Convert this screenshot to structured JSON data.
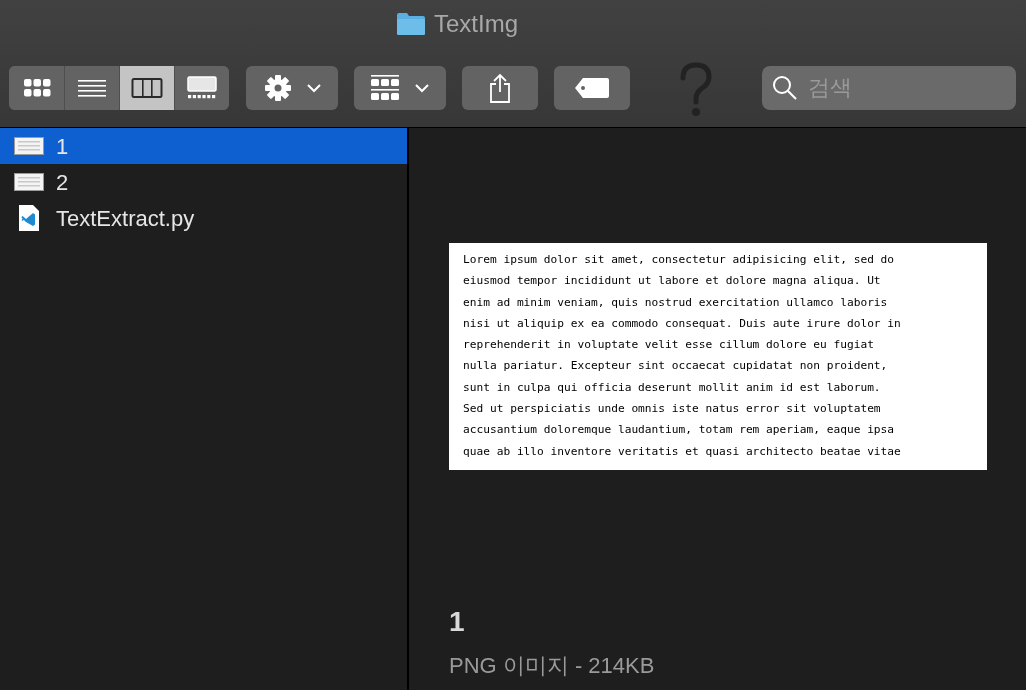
{
  "window": {
    "title": "TextImg"
  },
  "toolbar": {
    "views": [
      {
        "kind": "icons",
        "selected": false
      },
      {
        "kind": "list",
        "selected": false
      },
      {
        "kind": "columns",
        "selected": true
      },
      {
        "kind": "gallery",
        "selected": false
      }
    ],
    "search": {
      "placeholder": "검색"
    }
  },
  "files": [
    {
      "name": "1",
      "kind": "image",
      "selected": true
    },
    {
      "name": "2",
      "kind": "image",
      "selected": false
    },
    {
      "name": "TextExtract.py",
      "kind": "python",
      "selected": false
    }
  ],
  "preview": {
    "lines": [
      "Lorem ipsum dolor sit amet, consectetur adipisicing elit, sed do",
      "eiusmod tempor incididunt ut labore et dolore magna aliqua. Ut",
      "enim ad minim veniam, quis nostrud exercitation ullamco laboris",
      "nisi ut aliquip ex ea commodo consequat. Duis aute irure dolor in",
      "reprehenderit in voluptate velit esse cillum dolore eu fugiat",
      "nulla pariatur. Excepteur sint occaecat cupidatat non proident,",
      "sunt in culpa qui officia deserunt mollit anim id est laborum.",
      "Sed ut perspiciatis unde omnis iste natus error sit voluptatem",
      "accusantium doloremque laudantium, totam rem aperiam, eaque ipsa",
      "quae ab illo inventore veritatis et quasi architecto beatae vitae"
    ],
    "name": "1",
    "info": "PNG 이미지 - 214KB"
  }
}
